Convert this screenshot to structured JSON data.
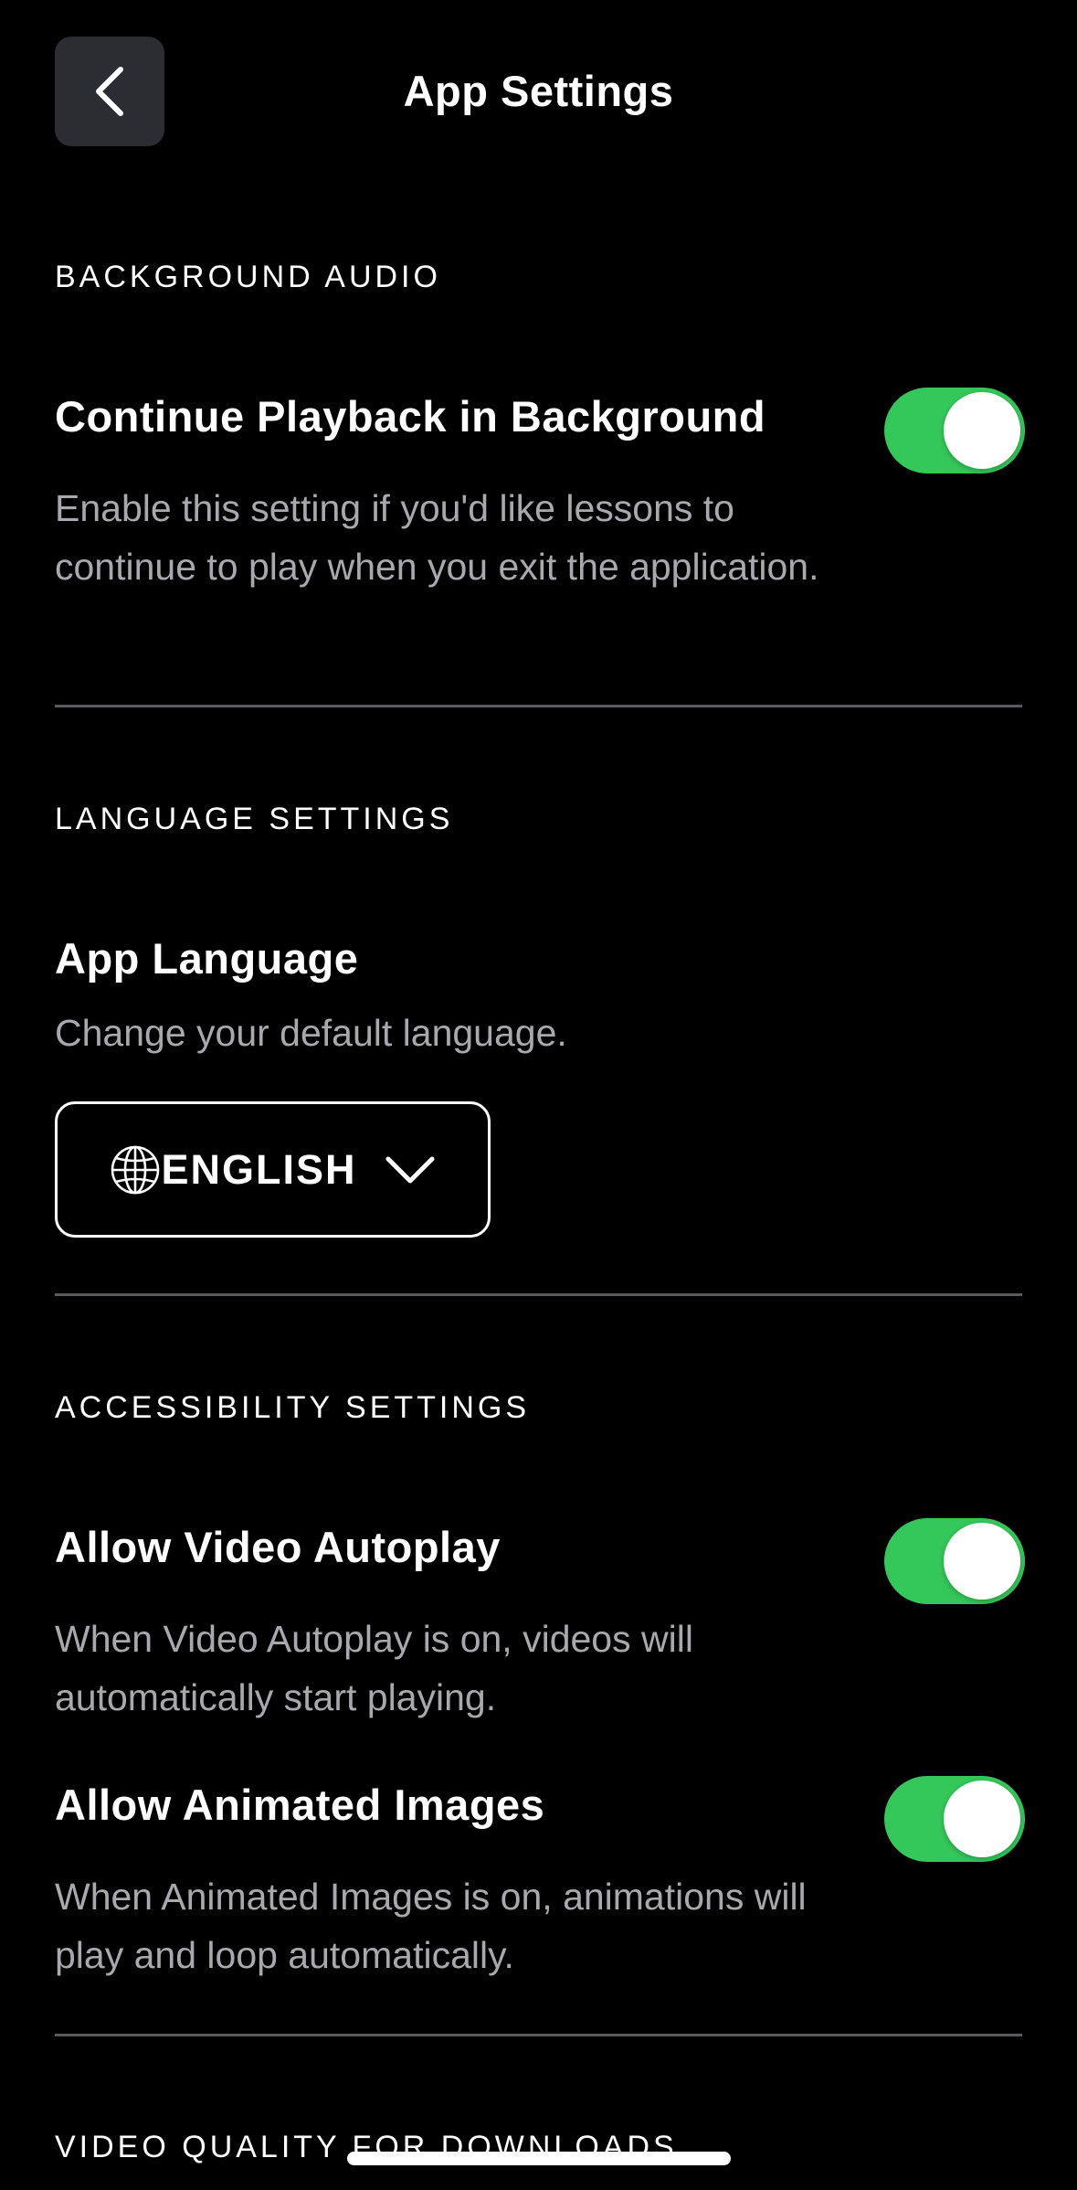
{
  "header": {
    "title": "App Settings",
    "back_icon": "chevron-left-icon"
  },
  "background_audio": {
    "section_label": "BACKGROUND AUDIO",
    "continue_playback": {
      "title": "Continue Playback in Background",
      "description": "Enable this setting if you'd like lessons to continue to play when you exit the application.",
      "enabled": true
    }
  },
  "language_settings": {
    "section_label": "LANGUAGE SETTINGS",
    "app_language": {
      "title": "App Language",
      "description": "Change your default language.",
      "selected": "ENGLISH",
      "icon": "globe-icon",
      "dropdown_icon": "chevron-down-icon"
    }
  },
  "accessibility_settings": {
    "section_label": "ACCESSIBILITY SETTINGS",
    "video_autoplay": {
      "title": "Allow Video Autoplay",
      "description": "When Video Autoplay is on, videos will automatically start playing.",
      "enabled": true
    },
    "animated_images": {
      "title": "Allow Animated Images",
      "description": "When Animated Images is on, animations will play and loop automatically.",
      "enabled": true
    }
  },
  "video_quality": {
    "section_label": "VIDEO QUALITY FOR DOWNLOADS"
  },
  "colors": {
    "background": "#000000",
    "toggle_on": "#34c759",
    "back_button_bg": "#2c2d33",
    "description_text": "#a8a8ad",
    "divider": "#5a5a5e"
  }
}
